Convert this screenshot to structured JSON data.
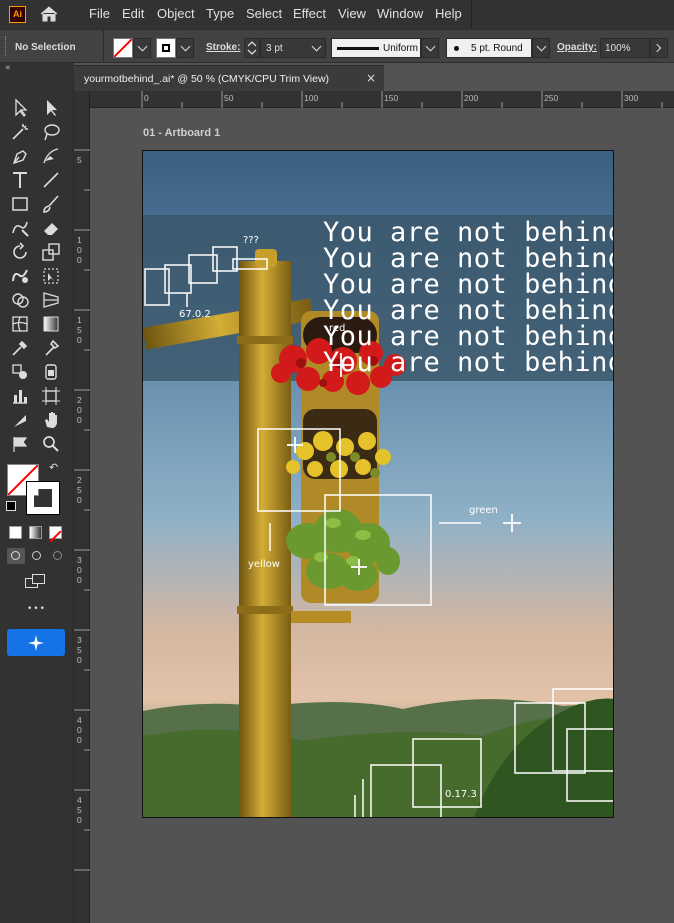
{
  "app": {
    "logo": "Ai"
  },
  "menu": [
    "File",
    "Edit",
    "Object",
    "Type",
    "Select",
    "Effect",
    "View",
    "Window",
    "Help"
  ],
  "control": {
    "selection": "No Selection",
    "stroke_label": "Stroke:",
    "stroke_weight": "3 pt",
    "stroke_profile": "Uniform",
    "brush": "5 pt. Round",
    "opacity_label": "Opacity:",
    "opacity_value": "100%"
  },
  "document": {
    "tab_title": "yourmotbehind_.ai* @ 50 % (CMYK/CPU Trim View)",
    "close_glyph": "×",
    "artboard_label": "01 - Artboard 1"
  },
  "ruler": {
    "top": [
      "0",
      "50",
      "100",
      "150",
      "200",
      "250",
      "300"
    ],
    "left": [
      "0",
      "5",
      "100",
      "150",
      "200",
      "250",
      "300",
      "350",
      "400",
      "450"
    ]
  },
  "artwork": {
    "headline_lines": [
      "You are not behind",
      "You are not behind",
      "You are not behind",
      "You are not behind",
      "You are not behind",
      "You are not behind"
    ],
    "labels": {
      "question": "???",
      "version_a": "67.0.2",
      "red": "red",
      "yellow": "yellow",
      "green": "green",
      "version_b": "0.17.3"
    }
  },
  "toolbar": {
    "more_glyph": "•••",
    "icons": [
      "selection-icon",
      "direct-selection-icon",
      "magic-wand-icon",
      "lasso-icon",
      "pen-icon",
      "curvature-icon",
      "type-icon",
      "line-icon",
      "rectangle-icon",
      "paintbrush-icon",
      "shaper-icon",
      "eraser-icon",
      "rotate-icon",
      "scale-icon",
      "warp-icon",
      "free-transform-icon",
      "shape-builder-icon",
      "perspective-icon",
      "mesh-icon",
      "gradient-icon",
      "eyedropper-icon",
      "blend-icon",
      "symbol-sprayer-icon",
      "column-graph-icon",
      "artboard-icon",
      "slice-icon",
      "hand-icon",
      "zoom-icon"
    ]
  },
  "colors": {
    "accent": "#1473e6",
    "chrome": "#323232",
    "canvas": "#535353",
    "stroke": "#ff0000"
  }
}
